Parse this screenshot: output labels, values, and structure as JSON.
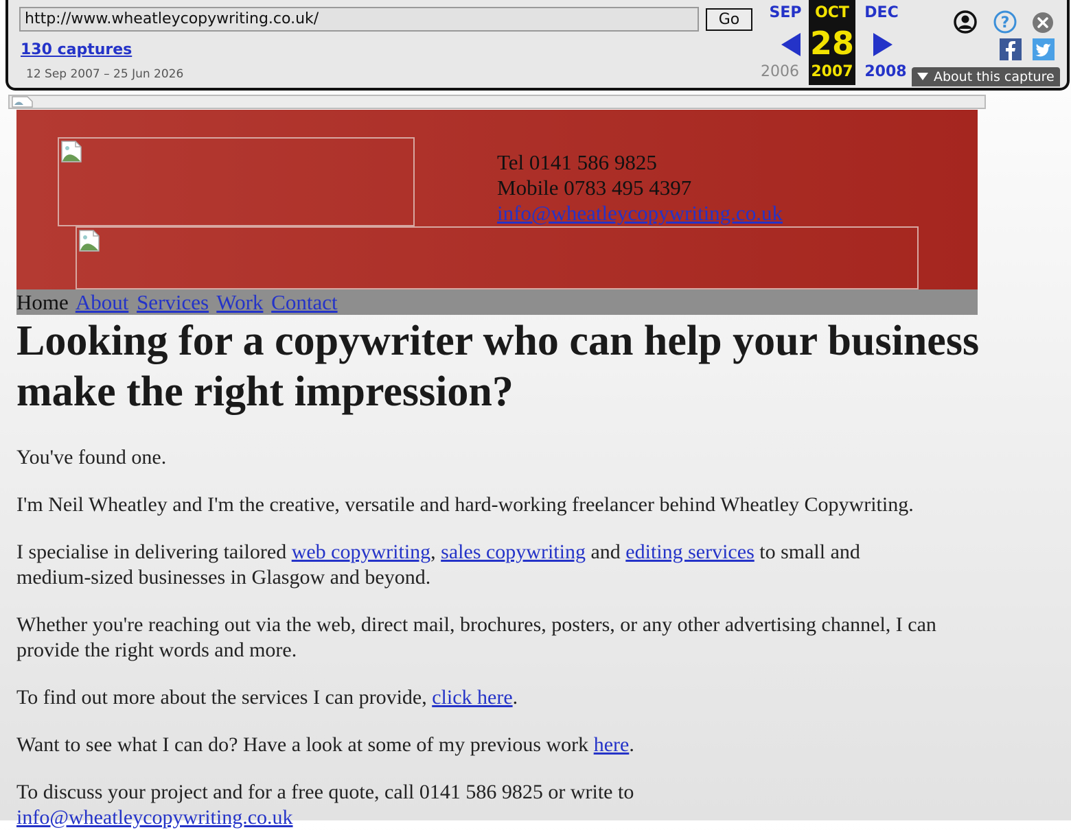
{
  "toolbar": {
    "url": "http://www.wheatleycopywriting.co.uk/",
    "go_label": "Go",
    "captures": "130 captures",
    "range": "12 Sep 2007 – 25 Jun 2026",
    "prev_month": "SEP",
    "cur_month": "OCT",
    "next_month": "DEC",
    "cur_day": "28",
    "prev_year": "2006",
    "cur_year": "2007",
    "next_year": "2008",
    "about": "About this capture",
    "icons": [
      "user-icon",
      "help-icon",
      "close-icon",
      "facebook-icon",
      "twitter-icon"
    ]
  },
  "header": {
    "tel": "Tel 0141 586 9825",
    "mobile": "Mobile 0783 495 4397",
    "email": "info@wheatleycopywriting.co.uk"
  },
  "nav": {
    "home": "Home",
    "about": "About",
    "services": "Services",
    "work": "Work",
    "contact": "Contact"
  },
  "content": {
    "headline": "Looking for a copywriter who can help your business make the right impression?",
    "p1": "You've found one.",
    "p2": "I'm Neil Wheatley and I'm the creative, versatile and hard-working freelancer behind Wheatley Copywriting.",
    "p3_a": "I specialise in delivering tailored ",
    "p3_link1": "web copywriting",
    "p3_b": ", ",
    "p3_link2": "sales copywriting",
    "p3_c": " and ",
    "p3_link3": "editing services",
    "p3_d": " to small and medium-sized businesses in Glasgow and beyond.",
    "p4": "Whether you're reaching out via the web, direct mail, brochures, posters, or any other advertising channel, I can provide the right words and more.",
    "p5_a": "To find out more about the services I can provide, ",
    "p5_link": "click here",
    "p5_b": ".",
    "p6_a": "Want to see what I can do? Have a look at some of my previous work ",
    "p6_link": "here",
    "p6_b": ".",
    "p7": "To discuss your project and for a free quote, call 0141 586 9825 or write to",
    "p7_link": "info@wheatleycopywriting.co.uk"
  },
  "colors": {
    "link": "#2433c8",
    "header_red": "#a5261f",
    "nav_gray": "#8e8e8e",
    "wayback_highlight": "#f2e200"
  }
}
